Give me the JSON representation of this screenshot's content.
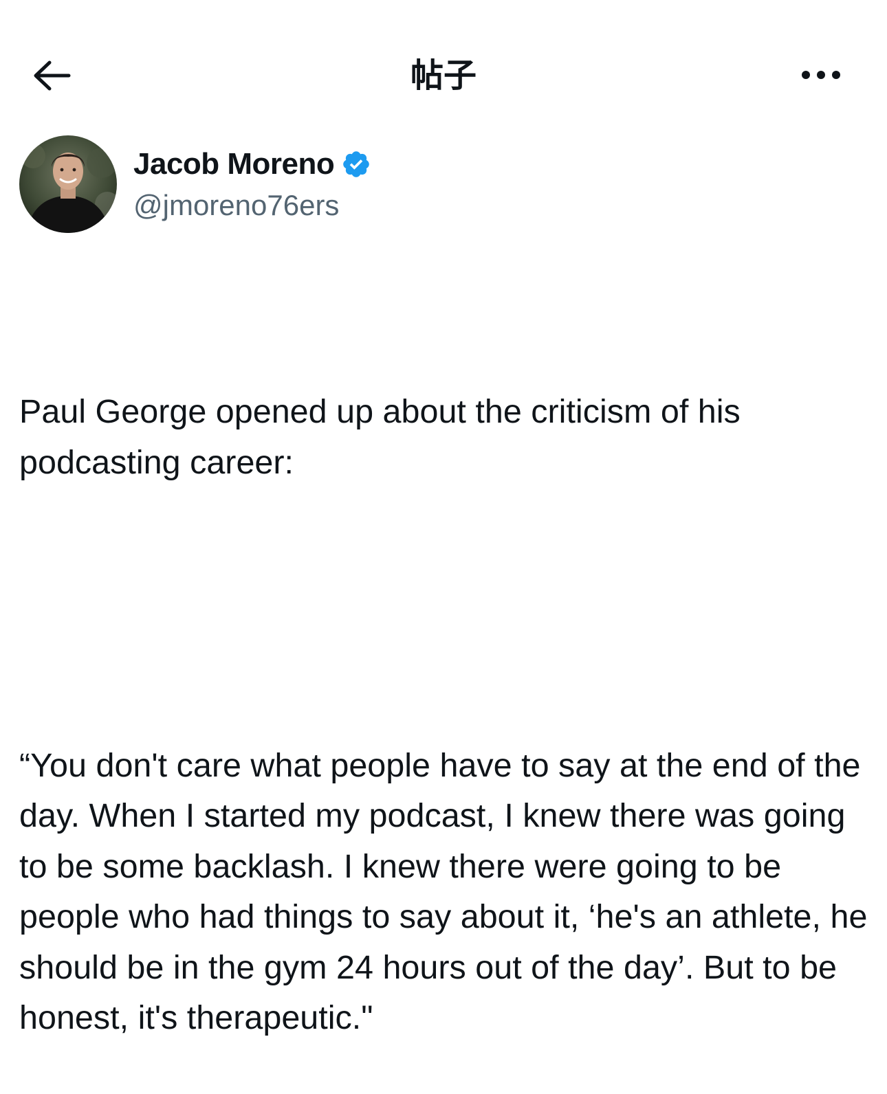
{
  "header": {
    "title": "帖子"
  },
  "icons": {
    "back": "arrow-left-icon",
    "more": "more-horizontal-icon",
    "verified": "verified-badge-icon"
  },
  "colors": {
    "verified": "#1d9bf0",
    "text_primary": "#0f1419",
    "text_secondary": "#536471"
  },
  "author": {
    "name": "Jacob Moreno",
    "handle": "@jmoreno76ers"
  },
  "post": {
    "paragraph_1": "Paul George opened up about the criticism of his podcasting career:",
    "paragraph_2": "“You don't care what people have to say at the end of the day. When I started my podcast, I knew there was going to be some backlash. I knew there were going to be people who had things to say about it, ‘he's an athlete, he should be in the gym 24 hours out of the day’. But to be honest, it's therapeutic.\""
  }
}
